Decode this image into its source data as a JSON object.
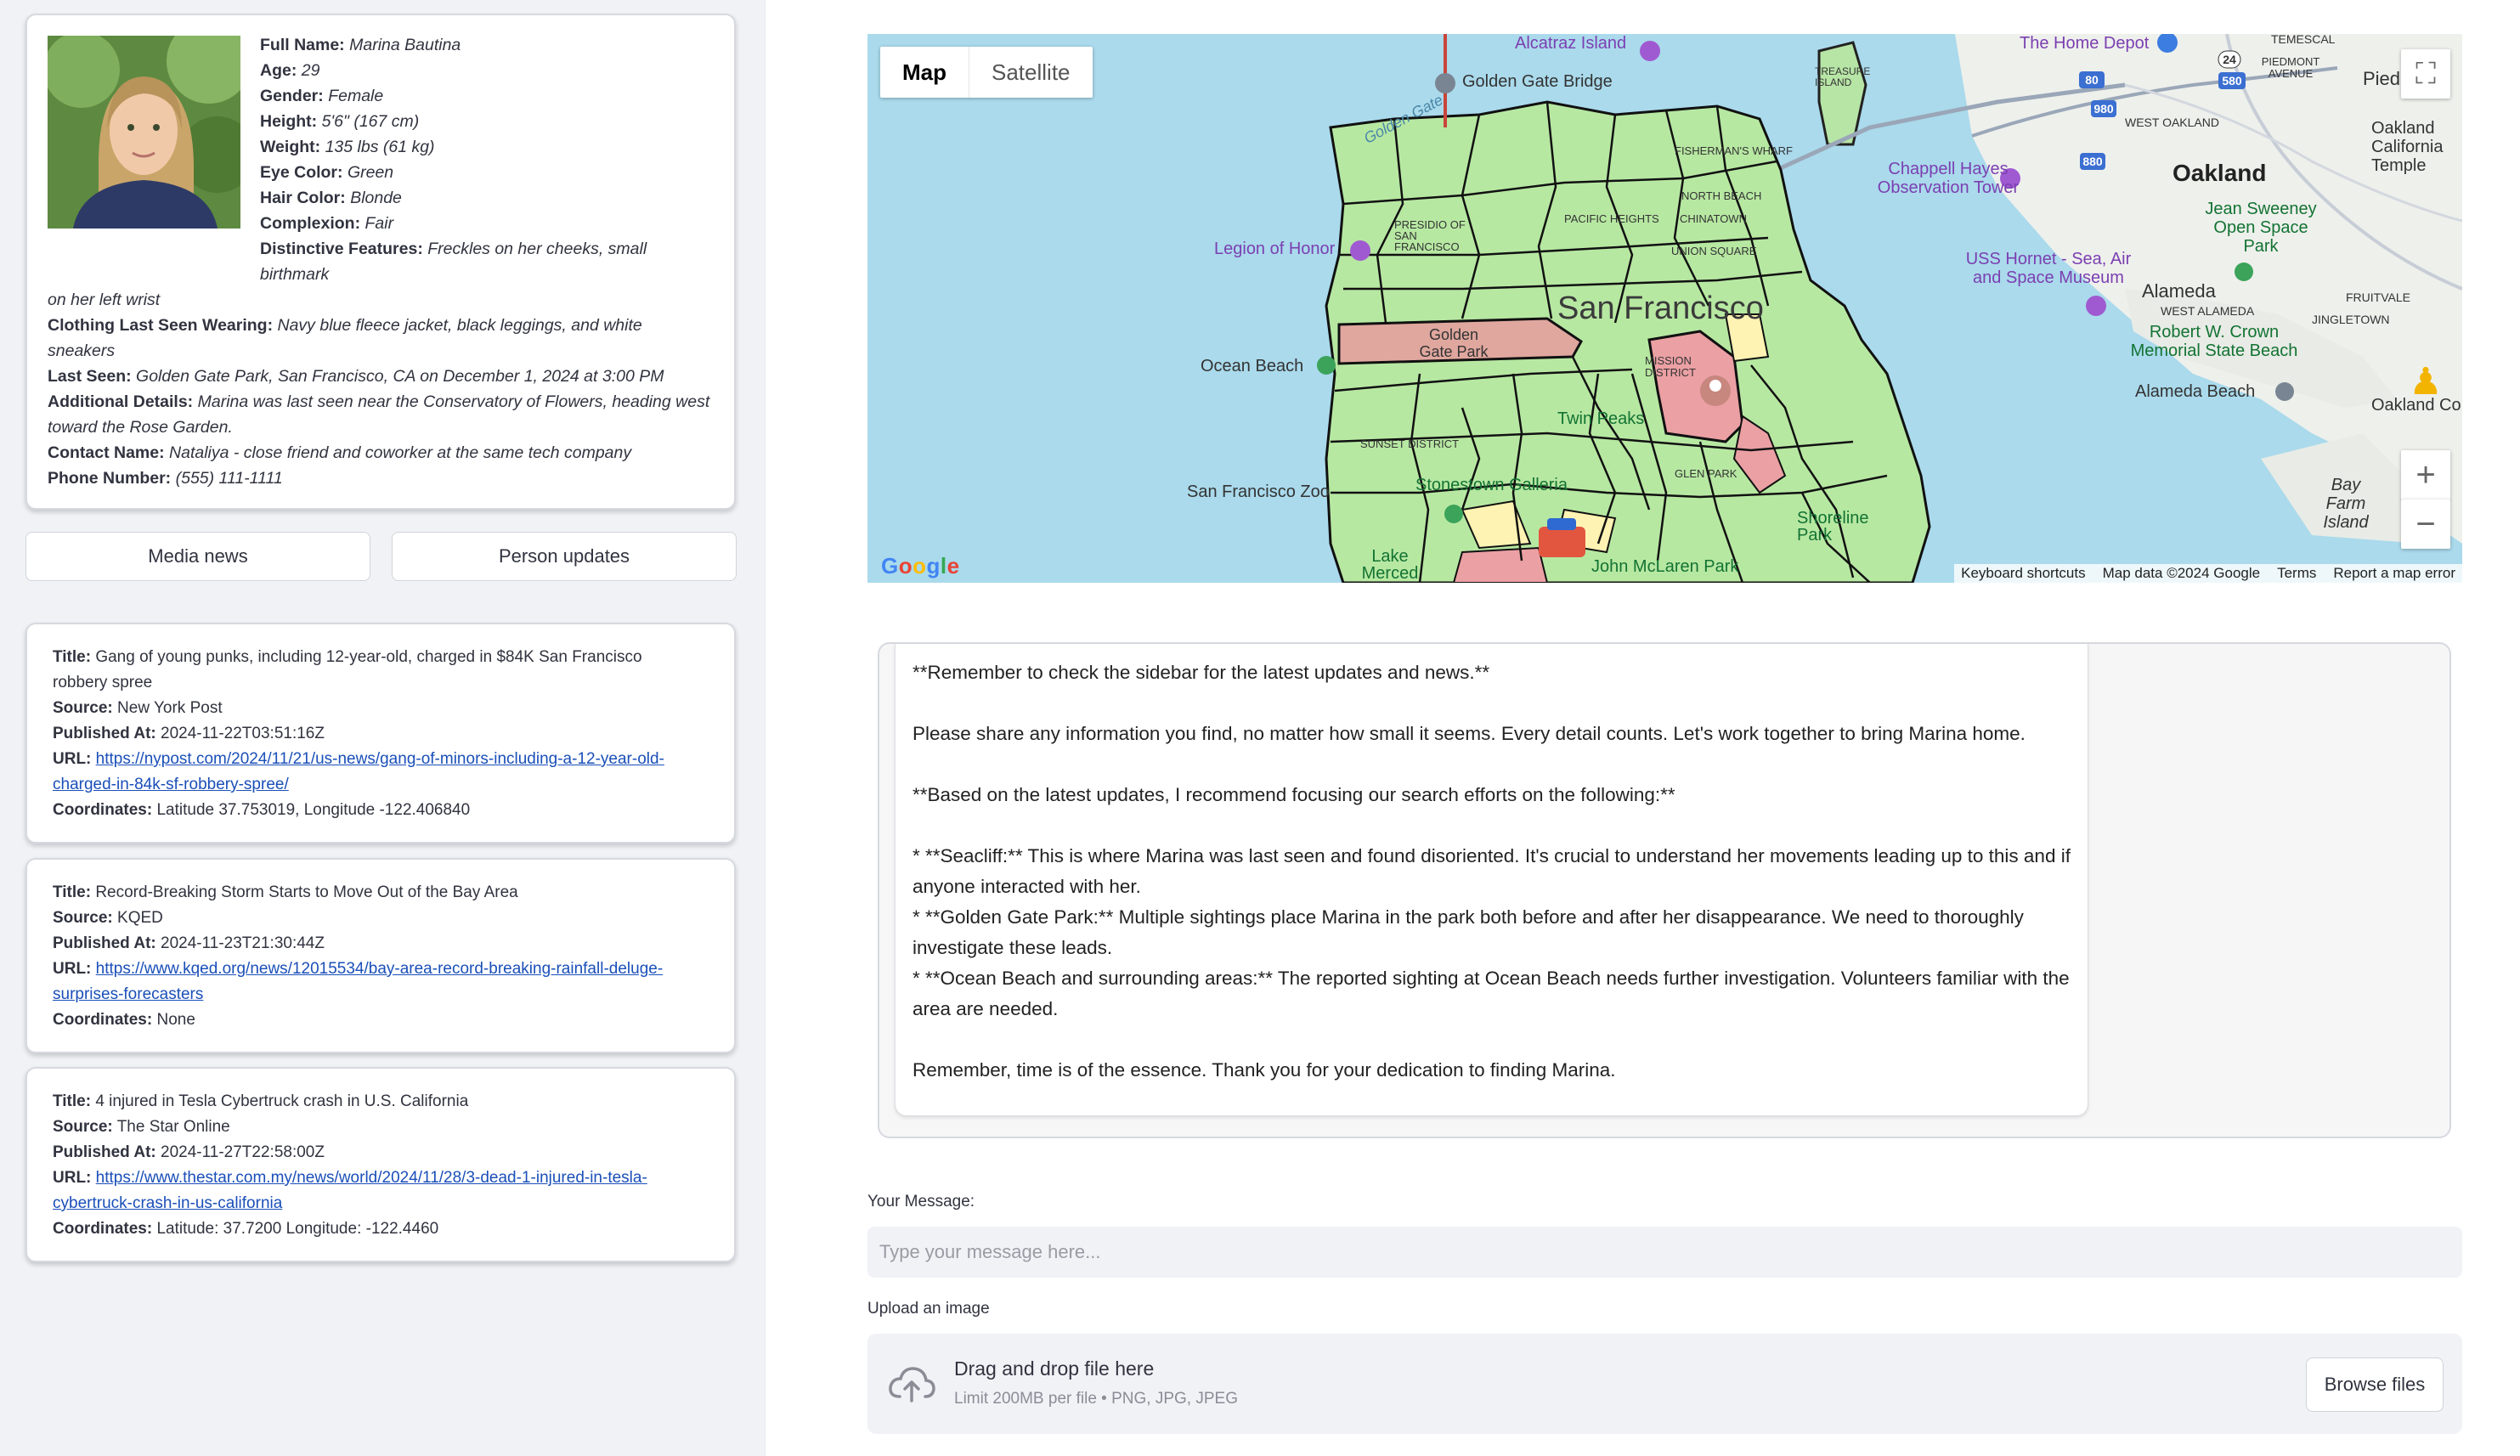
{
  "profile": {
    "full_name_label": "Full Name:",
    "full_name": "Marina Bautina",
    "age_label": "Age:",
    "age": "29",
    "gender_label": "Gender:",
    "gender": "Female",
    "height_label": "Height:",
    "height": "5'6\" (167 cm)",
    "weight_label": "Weight:",
    "weight": "135 lbs (61 kg)",
    "eye_label": "Eye Color:",
    "eye": "Green",
    "hair_label": "Hair Color:",
    "hair": "Blonde",
    "complexion_label": "Complexion:",
    "complexion": "Fair",
    "features_label": "Distinctive Features:",
    "features_a": "Freckles on her cheeks, small birthmark",
    "features_b": "on her left wrist",
    "clothing_label": "Clothing Last Seen Wearing:",
    "clothing": "Navy blue fleece jacket, black leggings, and white sneakers",
    "last_seen_label": "Last Seen:",
    "last_seen": "Golden Gate Park, San Francisco, CA on December 1, 2024 at 3:00 PM",
    "details_label": "Additional Details:",
    "details_a": "Marina was last seen near the Conservatory of Flowers, heading west",
    "details_b": "toward the Rose Garden.",
    "contact_label": "Contact Name:",
    "contact": "Nataliya - close friend and coworker at the same tech company",
    "phone_label": "Phone Number:",
    "phone": "(555) 111-1111"
  },
  "buttons": {
    "media": "Media news",
    "person": "Person updates"
  },
  "labels": {
    "title": "Title:",
    "source": "Source:",
    "published": "Published At:",
    "url": "URL:",
    "coords": "Coordinates:"
  },
  "news": [
    {
      "title_a": "Gang of young punks, including 12-year-old, charged in $84K San Francisco",
      "title_b": "robbery spree",
      "source": "New York Post",
      "published": "2024-11-22T03:51:16Z",
      "url_a": "https://nypost.com/2024/11/21/us-news/gang-of-minors-including-a-12-year-old-",
      "url_b": "charged-in-84k-sf-robbery-spree/",
      "coords": "Latitude 37.753019, Longitude -122.406840"
    },
    {
      "title_a": "Record-Breaking Storm Starts to Move Out of the Bay Area",
      "source": "KQED",
      "published": "2024-11-23T21:30:44Z",
      "url_a": "https://www.kqed.org/news/12015534/bay-area-record-breaking-rainfall-deluge-",
      "url_b": "surprises-forecasters",
      "coords": "None"
    },
    {
      "title_a": "4 injured in Tesla Cybertruck crash in U.S. California",
      "source": "The Star Online",
      "published": "2024-11-27T22:58:00Z",
      "url_a": "https://www.thestar.com.my/news/world/2024/11/28/3-dead-1-injured-in-tesla-",
      "url_b": "cybertruck-crash-in-us-california",
      "coords": "Latitude: 37.7200 Longitude: -122.4460"
    }
  ],
  "map": {
    "tabs": [
      "Map",
      "Satellite"
    ],
    "footer": [
      "Keyboard shortcuts",
      "Map data ©2024 Google",
      "Terms",
      "Report a map error"
    ],
    "logo": "Google",
    "labels": {
      "alcatraz": "Alcatraz Island",
      "ggbridge": "Golden Gate Bridge",
      "ggate": "Golden Gate",
      "treasure": "TREASURE ISLAND",
      "legion": "Legion of Honor",
      "presidio": "PRESIDIO OF SAN FRANCISCO",
      "sf": "San Francisco",
      "ggpark": "Golden Gate Park",
      "ocean_beach": "Ocean Beach",
      "sunset": "SUNSET DISTRICT",
      "mission": "MISSION DISTRICT",
      "twin": "Twin Peaks",
      "sfzoo": "San Francisco Zoo",
      "stonestown": "Stonestown Galleria",
      "lake": "Lake Merced Park",
      "mclaren": "John McLaren Park",
      "shoreline": "Shoreline Park",
      "chappell": "Chappell Hayes Observation Tower",
      "hornet": "USS Hornet - Sea, Air and Space Museum",
      "oakland": "Oakland",
      "alameda": "Alameda",
      "west_alameda": "WEST ALAMEDA",
      "crown": "Robert W. Crown Memorial State Beach",
      "alameda_beach": "Alameda Beach",
      "jean": "Jean Sweeney Open Space Park",
      "fruitvale": "FRUITVALE",
      "jingletown": "JINGLETOWN",
      "home_depot": "The Home Depot",
      "piedmont": "Piedmont",
      "temescal": "TEMESCAL",
      "piedmont_ave": "PIEDMONT AVENUE",
      "west_oakland": "WEST OAKLAND",
      "oakland_ca": "Oakland California Temple",
      "bayfarm": "Bay Farm Island",
      "oak_coliseum": "Oakland Coliseum",
      "north_beach": "NORTH BEACH",
      "pac_heights": "PACIFIC HEIGHTS",
      "chinatown": "CHINATOWN",
      "union_sq": "UNION SQUARE",
      "fin_wharf": "FISHERMAN'S WHARF",
      "daly": "GLEN PARK"
    },
    "road_badges": [
      "80",
      "24",
      "580",
      "980",
      "880"
    ]
  },
  "chat": {
    "p1": "**Remember to check the sidebar for the latest updates and news.**",
    "p2": "Please share any information you find, no matter how small it seems. Every detail counts. Let's work together to bring Marina home.",
    "p3": "**Based on the latest updates, I recommend focusing our search efforts on the following:**",
    "b1": "* **Seacliff:** This is where Marina was last seen and found disoriented. It's crucial to understand her movements leading up to this and if anyone interacted with her.",
    "b2": "* **Golden Gate Park:** Multiple sightings place Marina in the park both before and after her disappearance. We need to thoroughly investigate these leads.",
    "b3": "* **Ocean Beach and surrounding areas:**  The reported sighting at Ocean Beach needs further investigation. Volunteers familiar with the area are needed.",
    "p4": "Remember, time is of the essence. Thank you for your dedication to finding Marina."
  },
  "input": {
    "label": "Your Message:",
    "placeholder": "Type your message here..."
  },
  "upload": {
    "label": "Upload an image",
    "drag": "Drag and drop file here",
    "limit": "Limit 200MB per file • PNG, JPG, JPEG",
    "browse": "Browse files"
  }
}
